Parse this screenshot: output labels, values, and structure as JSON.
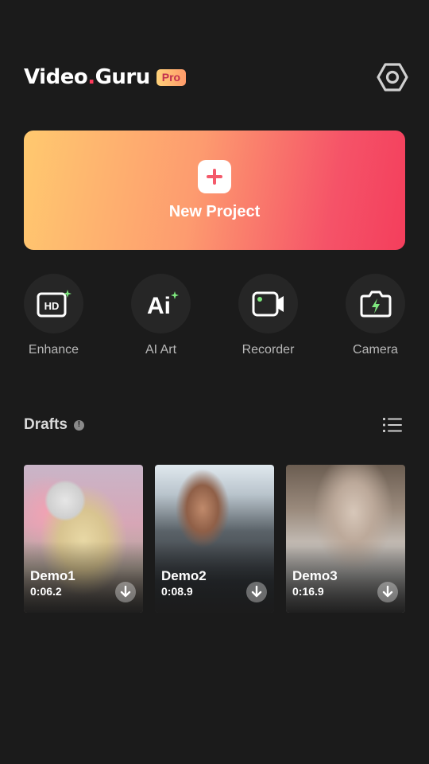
{
  "header": {
    "logo_part1": "Video",
    "logo_dot": ".",
    "logo_part2": "Guru",
    "badge": "Pro",
    "settings_icon": "settings-hexagon-icon"
  },
  "new_project": {
    "label": "New Project",
    "icon": "plus-icon"
  },
  "tools": [
    {
      "label": "Enhance",
      "icon": "hd-sparkle-icon"
    },
    {
      "label": "AI Art",
      "icon": "ai-sparkle-icon"
    },
    {
      "label": "Recorder",
      "icon": "screen-recorder-icon"
    },
    {
      "label": "Camera",
      "icon": "camera-flash-icon"
    }
  ],
  "drafts": {
    "title": "Drafts",
    "info_icon": "info-icon",
    "view_icon": "list-view-icon",
    "items": [
      {
        "name": "Demo1",
        "duration": "0:06.2"
      },
      {
        "name": "Demo2",
        "duration": "0:08.9"
      },
      {
        "name": "Demo3",
        "duration": "0:16.9"
      }
    ]
  },
  "colors": {
    "background": "#1b1b1b",
    "tool_circle": "#262626",
    "gradient_start": "#ffc96f",
    "gradient_end": "#f43e5c",
    "sparkle": "#7ee87e",
    "accent_pink": "#ff3b5c"
  }
}
